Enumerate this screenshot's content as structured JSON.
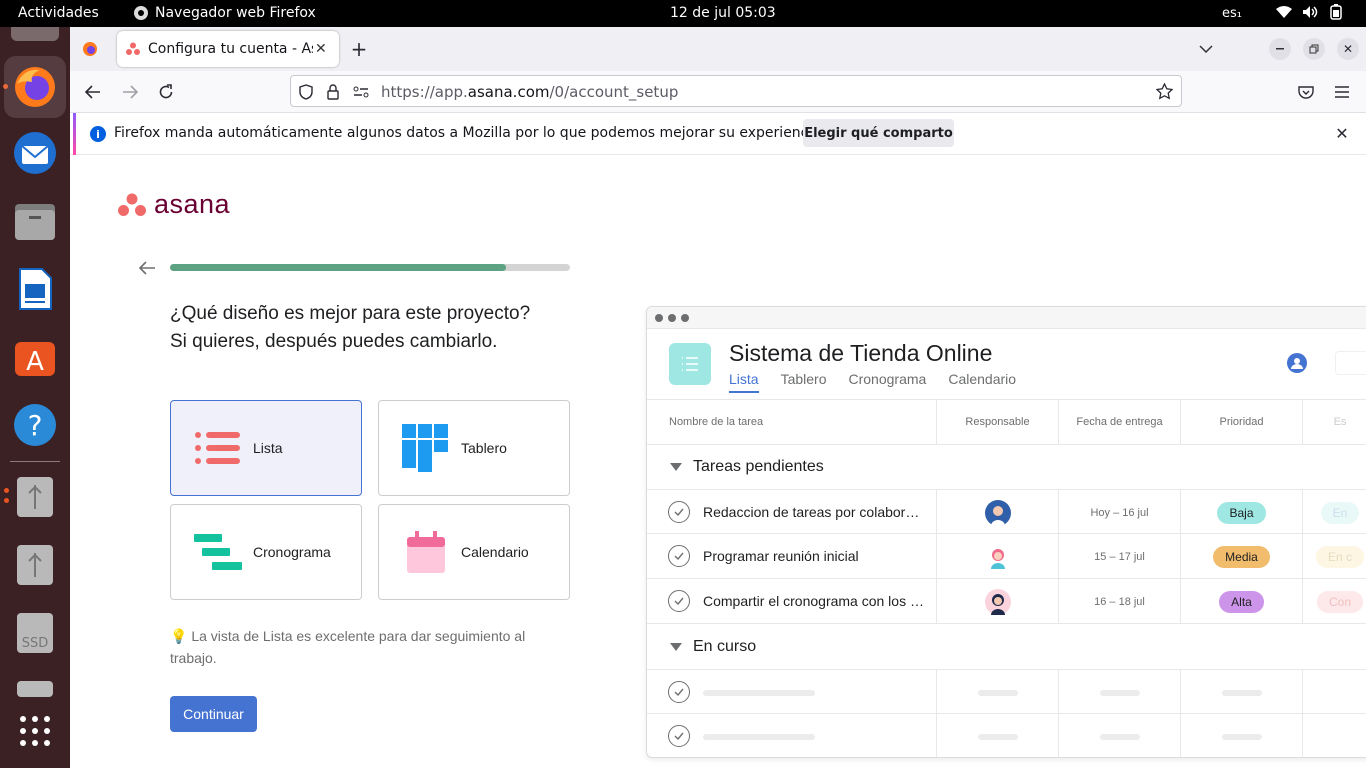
{
  "topbar": {
    "activities": "Actividades",
    "app_name": "Navegador web Firefox",
    "clock": "12 de jul  05:03",
    "lang": "es₁"
  },
  "browser": {
    "tab_title": "Configura tu cuenta - Asana",
    "url_prefix": "https://app.",
    "url_domain": "asana.com",
    "url_path": "/0/account_setup"
  },
  "notification": {
    "message": "Firefox manda automáticamente algunos datos a Mozilla por lo que podemos mejorar su experiencia.",
    "button": "Elegir qué comparto"
  },
  "page": {
    "logo_text": "asana",
    "progress": 0.84,
    "question_line1": "¿Qué diseño es mejor para este proyecto?",
    "question_line2": "Si quieres, después puedes cambiarlo.",
    "options": [
      "Lista",
      "Tablero",
      "Cronograma",
      "Calendario"
    ],
    "selected": "Lista",
    "hint": "La vista de Lista es excelente para dar seguimiento al trabajo.",
    "continue": "Continuar"
  },
  "preview": {
    "title": "Sistema de Tienda Online",
    "tabs": [
      "Lista",
      "Tablero",
      "Cronograma",
      "Calendario"
    ],
    "columns": [
      "Nombre de la tarea",
      "Responsable",
      "Fecha de entrega",
      "Prioridad",
      "Es"
    ],
    "section1": "Tareas pendientes",
    "section2": "En curso",
    "tasks": [
      {
        "name": "Redaccion de tareas por colaborador",
        "date": "Hoy – 16 jul",
        "priority": "Baja",
        "status": "En"
      },
      {
        "name": "Programar reunión inicial",
        "date": "15 – 17 jul",
        "priority": "Media",
        "status": "En c"
      },
      {
        "name": "Compartir el cronograma con los compañeros",
        "date": "16 – 18 jul",
        "priority": "Alta",
        "status": "Con"
      }
    ]
  },
  "colors": {
    "accent": "#4573d2",
    "asana_coral": "#f06a6a",
    "progress": "#5da283",
    "baja": "#9ee7e3",
    "media": "#f8df72",
    "alta": "#e362e3"
  }
}
